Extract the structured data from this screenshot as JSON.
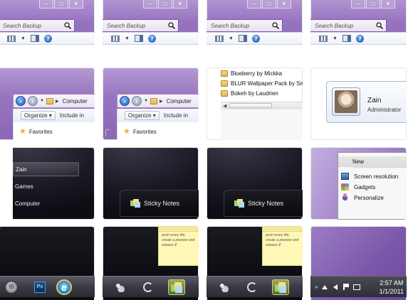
{
  "row0": {
    "search_placeholder": "Search Backup",
    "help_glyph": "?",
    "window_buttons": [
      "–",
      "□",
      "✕"
    ]
  },
  "explorer": {
    "breadcrumb": "Computer",
    "organize": "Organize",
    "include": "Include in",
    "favorites": "Favorites"
  },
  "wallpapers": {
    "items": [
      "Blueberry by Mickka",
      "BLUR Wallpaper Pack by Smac",
      "Bokeh by Laudrien"
    ]
  },
  "user": {
    "name": "Zain",
    "role": "Administrator"
  },
  "start_menu": {
    "items": [
      "Zain",
      "Games",
      "Computer"
    ]
  },
  "sticky": {
    "label": "Sticky Notes",
    "note_text": "push every file, create a preview and release it!"
  },
  "context_menu": {
    "items": [
      {
        "label": "New",
        "icon": "none"
      },
      {
        "label": "Screen resolution",
        "icon": "monitor-icon"
      },
      {
        "label": "Gadgets",
        "icon": "gadgets-icon"
      },
      {
        "label": "Personalize",
        "icon": "personalize-icon"
      }
    ]
  },
  "taskbar": {
    "ps_label": "Ps",
    "ie_label": "e"
  },
  "tray": {
    "time": "2:57 AM",
    "date": "1/1/2011"
  }
}
